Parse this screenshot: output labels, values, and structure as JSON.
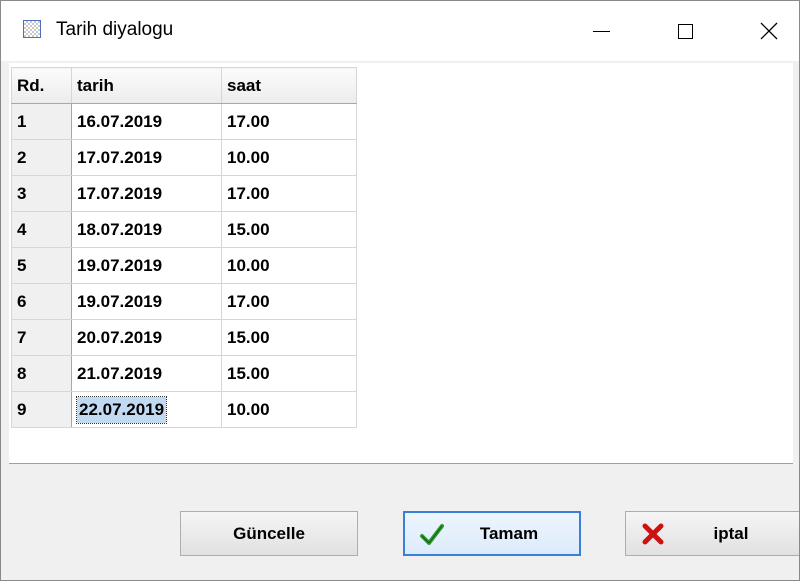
{
  "window": {
    "title": "Tarih diyalogu",
    "icon": "checkered-app-icon",
    "controls": [
      "minimize-icon",
      "maximize-icon",
      "close-icon"
    ]
  },
  "grid": {
    "headers": {
      "rd": "Rd.",
      "tarih": "tarih",
      "saat": "saat"
    },
    "rows": [
      {
        "rd": "1",
        "tarih": "16.07.2019",
        "saat": "17.00"
      },
      {
        "rd": "2",
        "tarih": "17.07.2019",
        "saat": "10.00"
      },
      {
        "rd": "3",
        "tarih": "17.07.2019",
        "saat": "17.00"
      },
      {
        "rd": "4",
        "tarih": "18.07.2019",
        "saat": "15.00"
      },
      {
        "rd": "5",
        "tarih": "19.07.2019",
        "saat": "10.00"
      },
      {
        "rd": "6",
        "tarih": "19.07.2019",
        "saat": "17.00"
      },
      {
        "rd": "7",
        "tarih": "20.07.2019",
        "saat": "15.00"
      },
      {
        "rd": "8",
        "tarih": "21.07.2019",
        "saat": "15.00"
      },
      {
        "rd": "9",
        "tarih": "22.07.2019",
        "saat": "10.00"
      }
    ],
    "selected_cell": {
      "row": 9,
      "column": "tarih"
    }
  },
  "buttons": {
    "guncelle": "Güncelle",
    "tamam": "Tamam",
    "iptal": "iptal"
  },
  "colors": {
    "selection": "#c2d9f2",
    "default_button_border": "#3c7fd6",
    "check_green": "#2e9a2e",
    "cross_red": "#cc1111"
  }
}
